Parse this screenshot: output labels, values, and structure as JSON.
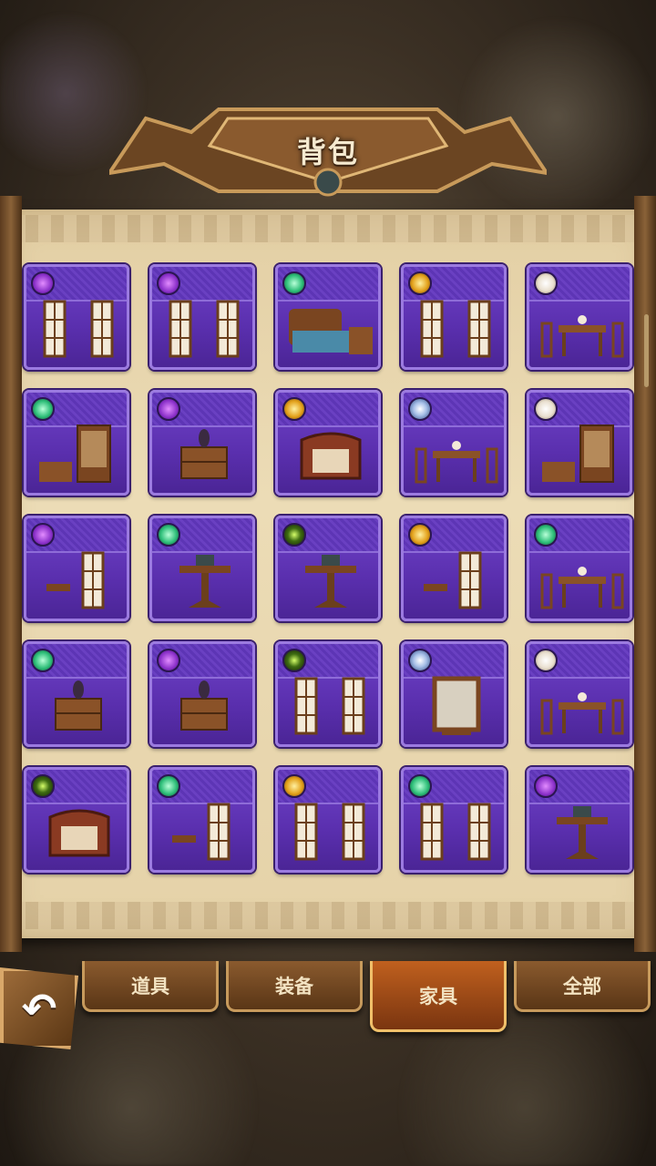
{
  "header": {
    "title": "背包"
  },
  "tabs": [
    {
      "label": "道具",
      "active": false
    },
    {
      "label": "装备",
      "active": false
    },
    {
      "label": "家具",
      "active": true
    },
    {
      "label": "全部",
      "active": false
    }
  ],
  "back_icon": "back-arrow-icon",
  "items": [
    {
      "gem": "purple",
      "furniture": "window"
    },
    {
      "gem": "purple",
      "furniture": "window"
    },
    {
      "gem": "green",
      "furniture": "bed"
    },
    {
      "gem": "gold",
      "furniture": "window"
    },
    {
      "gem": "white",
      "furniture": "dining-set"
    },
    {
      "gem": "green",
      "furniture": "cabinet"
    },
    {
      "gem": "purple",
      "furniture": "nightstand"
    },
    {
      "gem": "gold",
      "furniture": "armchair"
    },
    {
      "gem": "blue",
      "furniture": "dining-set"
    },
    {
      "gem": "white",
      "furniture": "cabinet"
    },
    {
      "gem": "purple",
      "furniture": "window-small"
    },
    {
      "gem": "green",
      "furniture": "side-table"
    },
    {
      "gem": "dark",
      "furniture": "side-table"
    },
    {
      "gem": "gold",
      "furniture": "window-small"
    },
    {
      "gem": "green",
      "furniture": "dining-set"
    },
    {
      "gem": "green",
      "furniture": "nightstand"
    },
    {
      "gem": "purple",
      "furniture": "nightstand"
    },
    {
      "gem": "dark",
      "furniture": "window"
    },
    {
      "gem": "blue",
      "furniture": "mirror"
    },
    {
      "gem": "white",
      "furniture": "dining-set"
    },
    {
      "gem": "dark",
      "furniture": "armchair"
    },
    {
      "gem": "green",
      "furniture": "window-small"
    },
    {
      "gem": "gold",
      "furniture": "window"
    },
    {
      "gem": "green",
      "furniture": "window"
    },
    {
      "gem": "purple",
      "furniture": "side-table"
    }
  ]
}
